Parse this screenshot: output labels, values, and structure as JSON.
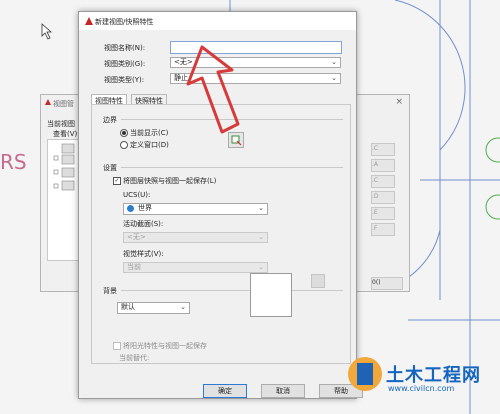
{
  "background": {
    "side_text": "RS",
    "dialog_title": "视图管",
    "current_view_label": "当前视图",
    "view_menu_label": "查看(V)",
    "close_glyph": "×",
    "buttons": [
      ".C",
      ".A",
      ".C",
      ".D",
      ".E",
      ".F"
    ],
    "ok_partial": "0()"
  },
  "dialog": {
    "title": "新建视图/快照特性",
    "close_glyph": "×",
    "view_name_label": "视图名称(N):",
    "view_name_value": "",
    "view_category_label": "视图类别(G):",
    "view_category_value": "<无>",
    "view_type_label": "视图类型(Y):",
    "view_type_value": "静止",
    "tabs": [
      "视图特性",
      "快照特性"
    ],
    "boundary": {
      "title": "边界",
      "current_display": "当前显示(C)",
      "define_window": "定义窗口(D)"
    },
    "settings": {
      "title": "设置",
      "save_layer_snapshot": "将图层快照与视图一起保存(L)",
      "ucs_label": "UCS(U):",
      "ucs_value": "世界",
      "live_section_label": "活动截面(S):",
      "live_section_value": "<无>",
      "visual_style_label": "视觉样式(V):",
      "visual_style_value": "当前"
    },
    "background": {
      "title": "背景",
      "value": "默认",
      "save_sun": "将阳光特性与视图一起保存",
      "current_override": "当前替代:"
    },
    "buttons": {
      "ok": "确定",
      "cancel": "取消",
      "help": "帮助"
    }
  },
  "watermark": {
    "brand": "土木工程网",
    "url": "www.civilcn.com"
  },
  "colors": {
    "arrow": "#d63a3a",
    "accent": "#2a7ad6",
    "watermark": "#1565c0"
  }
}
